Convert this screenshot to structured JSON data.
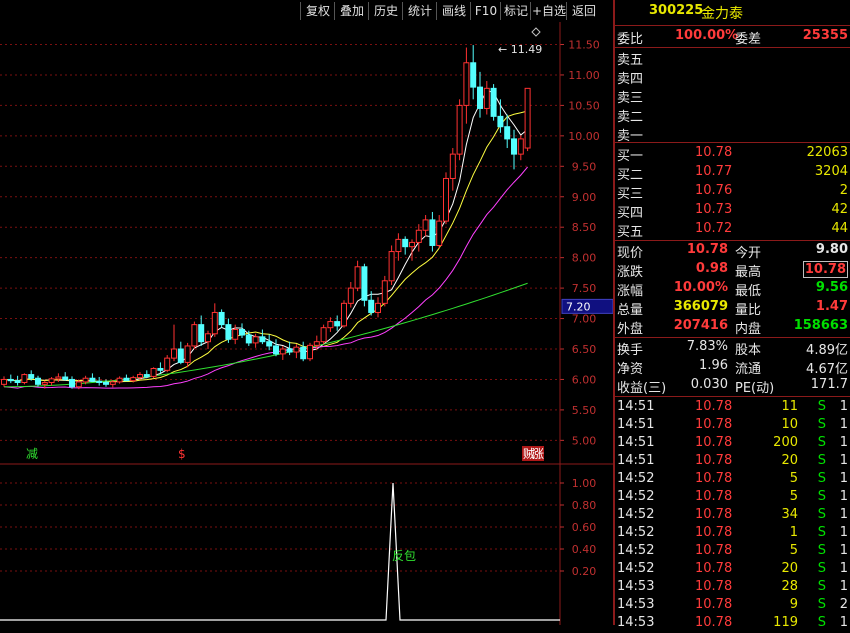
{
  "toolbar": {
    "buttons": [
      "复权",
      "叠加",
      "历史",
      "统计",
      "画线",
      "F10",
      "标记",
      "+自选",
      "返回"
    ]
  },
  "stock": {
    "code": "300225",
    "name": "金力泰"
  },
  "main_chart": {
    "price_ticks": [
      "11.50",
      "11.00",
      "10.50",
      "10.00",
      "9.50",
      "9.00",
      "8.50",
      "8.00",
      "7.50",
      "7.00",
      "6.50",
      "6.00",
      "5.50",
      "5.00"
    ],
    "current_marker": "7.20",
    "high_label": "11.49",
    "signal_labels": {
      "left": "减",
      "mid": "$",
      "right_a": "贼",
      "right_b": "涨"
    }
  },
  "indicator": {
    "ticks": [
      "1.00",
      "0.80",
      "0.60",
      "0.40",
      "0.20"
    ],
    "label": "反包"
  },
  "chart_data": {
    "type": "candlestick",
    "ylim": [
      4.8,
      11.75
    ],
    "candles": [
      [
        5.92,
        6.05,
        5.88,
        6.0
      ],
      [
        6.0,
        6.08,
        5.94,
        5.98
      ],
      [
        5.98,
        6.06,
        5.9,
        5.95
      ],
      [
        5.95,
        6.1,
        5.92,
        6.08
      ],
      [
        6.08,
        6.15,
        5.98,
        6.02
      ],
      [
        6.02,
        6.06,
        5.88,
        5.92
      ],
      [
        5.92,
        5.98,
        5.85,
        5.95
      ],
      [
        5.95,
        6.04,
        5.9,
        6.01
      ],
      [
        6.01,
        6.1,
        5.96,
        6.04
      ],
      [
        6.04,
        6.12,
        5.98,
        6.0
      ],
      [
        6.0,
        6.05,
        5.85,
        5.88
      ],
      [
        5.88,
        6.0,
        5.84,
        5.96
      ],
      [
        5.96,
        6.06,
        5.92,
        6.02
      ],
      [
        6.02,
        6.1,
        5.96,
        5.97
      ],
      [
        5.97,
        6.04,
        5.9,
        5.95
      ],
      [
        5.95,
        6.0,
        5.88,
        5.92
      ],
      [
        5.92,
        5.99,
        5.87,
        5.96
      ],
      [
        5.96,
        6.05,
        5.93,
        6.02
      ],
      [
        6.02,
        6.08,
        5.97,
        5.98
      ],
      [
        5.98,
        6.06,
        5.95,
        6.03
      ],
      [
        6.03,
        6.12,
        6.0,
        6.08
      ],
      [
        6.08,
        6.15,
        6.02,
        6.05
      ],
      [
        6.05,
        6.2,
        6.02,
        6.18
      ],
      [
        6.18,
        6.28,
        6.1,
        6.15
      ],
      [
        6.15,
        6.4,
        6.12,
        6.35
      ],
      [
        6.35,
        6.9,
        6.3,
        6.5
      ],
      [
        6.5,
        6.62,
        6.25,
        6.28
      ],
      [
        6.28,
        6.6,
        6.2,
        6.55
      ],
      [
        6.55,
        6.95,
        6.5,
        6.9
      ],
      [
        6.9,
        7.05,
        6.55,
        6.62
      ],
      [
        6.62,
        6.8,
        6.5,
        6.75
      ],
      [
        6.75,
        7.25,
        6.7,
        7.1
      ],
      [
        7.1,
        7.15,
        6.85,
        6.9
      ],
      [
        6.9,
        7.0,
        6.6,
        6.66
      ],
      [
        6.66,
        6.9,
        6.58,
        6.82
      ],
      [
        6.82,
        6.92,
        6.68,
        6.73
      ],
      [
        6.73,
        6.8,
        6.55,
        6.6
      ],
      [
        6.6,
        6.75,
        6.52,
        6.7
      ],
      [
        6.7,
        6.82,
        6.58,
        6.62
      ],
      [
        6.62,
        6.74,
        6.48,
        6.55
      ],
      [
        6.55,
        6.66,
        6.38,
        6.42
      ],
      [
        6.42,
        6.55,
        6.32,
        6.5
      ],
      [
        6.5,
        6.62,
        6.4,
        6.45
      ],
      [
        6.45,
        6.58,
        6.35,
        6.53
      ],
      [
        6.53,
        6.62,
        6.3,
        6.34
      ],
      [
        6.34,
        6.6,
        6.3,
        6.56
      ],
      [
        6.56,
        6.72,
        6.48,
        6.62
      ],
      [
        6.62,
        6.9,
        6.58,
        6.85
      ],
      [
        6.85,
        7.02,
        6.78,
        6.95
      ],
      [
        6.95,
        7.05,
        6.8,
        6.88
      ],
      [
        6.88,
        7.3,
        6.85,
        7.25
      ],
      [
        7.25,
        7.6,
        7.18,
        7.5
      ],
      [
        7.5,
        7.95,
        7.45,
        7.85
      ],
      [
        7.85,
        7.9,
        7.2,
        7.3
      ],
      [
        7.3,
        7.45,
        7.05,
        7.1
      ],
      [
        7.1,
        7.35,
        7.02,
        7.25
      ],
      [
        7.25,
        7.7,
        7.2,
        7.62
      ],
      [
        7.62,
        8.2,
        7.55,
        8.1
      ],
      [
        8.1,
        8.4,
        7.95,
        8.3
      ],
      [
        8.3,
        8.35,
        8.05,
        8.18
      ],
      [
        8.18,
        8.3,
        7.95,
        8.25
      ],
      [
        8.25,
        8.55,
        8.1,
        8.45
      ],
      [
        8.45,
        8.7,
        8.35,
        8.62
      ],
      [
        8.62,
        8.75,
        8.1,
        8.2
      ],
      [
        8.2,
        8.7,
        8.15,
        8.6
      ],
      [
        8.6,
        9.4,
        8.55,
        9.3
      ],
      [
        9.3,
        9.8,
        9.1,
        9.7
      ],
      [
        9.7,
        10.6,
        9.6,
        10.5
      ],
      [
        10.5,
        11.45,
        10.2,
        11.2
      ],
      [
        11.2,
        11.49,
        10.6,
        10.8
      ],
      [
        10.8,
        11.05,
        10.3,
        10.45
      ],
      [
        10.45,
        10.9,
        10.35,
        10.78
      ],
      [
        10.78,
        10.85,
        10.25,
        10.32
      ],
      [
        10.32,
        10.6,
        10.05,
        10.15
      ],
      [
        10.15,
        10.35,
        9.8,
        9.95
      ],
      [
        9.95,
        10.1,
        9.45,
        9.7
      ],
      [
        9.7,
        10.0,
        9.6,
        9.95
      ],
      [
        9.8,
        10.78,
        9.75,
        10.78
      ]
    ]
  },
  "quote": {
    "weibi_label": "委比",
    "weibi": "100.00%",
    "weicha_label": "委差",
    "weicha": "25355",
    "asks": [
      {
        "label": "卖五",
        "price": "",
        "vol": ""
      },
      {
        "label": "卖四",
        "price": "",
        "vol": ""
      },
      {
        "label": "卖三",
        "price": "",
        "vol": ""
      },
      {
        "label": "卖二",
        "price": "",
        "vol": ""
      },
      {
        "label": "卖一",
        "price": "",
        "vol": ""
      }
    ],
    "bids": [
      {
        "label": "买一",
        "price": "10.78",
        "vol": "22063"
      },
      {
        "label": "买二",
        "price": "10.77",
        "vol": "3204"
      },
      {
        "label": "买三",
        "price": "10.76",
        "vol": "2"
      },
      {
        "label": "买四",
        "price": "10.73",
        "vol": "42"
      },
      {
        "label": "买五",
        "price": "10.72",
        "vol": "44"
      }
    ],
    "stats": [
      {
        "l1": "现价",
        "v1": "10.78",
        "c1": "red",
        "l2": "今开",
        "v2": "9.80",
        "c2": "white"
      },
      {
        "l1": "涨跌",
        "v1": "0.98",
        "c1": "red",
        "l2": "最高",
        "v2": "10.78",
        "c2": "red"
      },
      {
        "l1": "涨幅",
        "v1": "10.00%",
        "c1": "red",
        "l2": "最低",
        "v2": "9.56",
        "c2": "green"
      },
      {
        "l1": "总量",
        "v1": "366079",
        "c1": "yellow",
        "l2": "量比",
        "v2": "1.47",
        "c2": "red"
      },
      {
        "l1": "外盘",
        "v1": "207416",
        "c1": "red",
        "l2": "内盘",
        "v2": "158663",
        "c2": "green"
      }
    ],
    "fin": [
      {
        "l1": "换手",
        "v1": "7.83%",
        "l2": "股本",
        "v2": "4.89亿"
      },
      {
        "l1": "净资",
        "v1": "1.96",
        "l2": "流通",
        "v2": "4.67亿"
      },
      {
        "l1": "收益(三)",
        "v1": "0.030",
        "l2": "PE(动)",
        "v2": "171.7"
      }
    ]
  },
  "ticks": [
    {
      "time": "14:51",
      "price": "10.78",
      "vol": "11",
      "side": "S",
      "num": "1"
    },
    {
      "time": "14:51",
      "price": "10.78",
      "vol": "10",
      "side": "S",
      "num": "1"
    },
    {
      "time": "14:51",
      "price": "10.78",
      "vol": "200",
      "side": "S",
      "num": "1"
    },
    {
      "time": "14:51",
      "price": "10.78",
      "vol": "20",
      "side": "S",
      "num": "1"
    },
    {
      "time": "14:52",
      "price": "10.78",
      "vol": "5",
      "side": "S",
      "num": "1"
    },
    {
      "time": "14:52",
      "price": "10.78",
      "vol": "5",
      "side": "S",
      "num": "1"
    },
    {
      "time": "14:52",
      "price": "10.78",
      "vol": "34",
      "side": "S",
      "num": "1"
    },
    {
      "time": "14:52",
      "price": "10.78",
      "vol": "1",
      "side": "S",
      "num": "1"
    },
    {
      "time": "14:52",
      "price": "10.78",
      "vol": "5",
      "side": "S",
      "num": "1"
    },
    {
      "time": "14:52",
      "price": "10.78",
      "vol": "20",
      "side": "S",
      "num": "1"
    },
    {
      "time": "14:53",
      "price": "10.78",
      "vol": "28",
      "side": "S",
      "num": "1"
    },
    {
      "time": "14:53",
      "price": "10.78",
      "vol": "9",
      "side": "S",
      "num": "2"
    },
    {
      "time": "14:53",
      "price": "10.78",
      "vol": "119",
      "side": "S",
      "num": "1"
    }
  ]
}
